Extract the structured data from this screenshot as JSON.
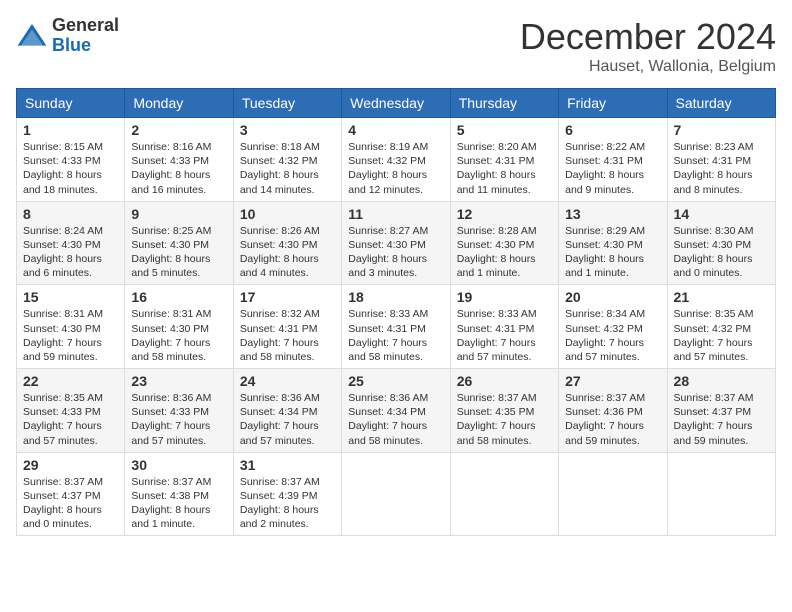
{
  "logo": {
    "general": "General",
    "blue": "Blue"
  },
  "title": "December 2024",
  "location": "Hauset, Wallonia, Belgium",
  "days_of_week": [
    "Sunday",
    "Monday",
    "Tuesday",
    "Wednesday",
    "Thursday",
    "Friday",
    "Saturday"
  ],
  "weeks": [
    [
      {
        "day": 1,
        "sunrise": "8:15 AM",
        "sunset": "4:33 PM",
        "daylight": "8 hours and 18 minutes."
      },
      {
        "day": 2,
        "sunrise": "8:16 AM",
        "sunset": "4:33 PM",
        "daylight": "8 hours and 16 minutes."
      },
      {
        "day": 3,
        "sunrise": "8:18 AM",
        "sunset": "4:32 PM",
        "daylight": "8 hours and 14 minutes."
      },
      {
        "day": 4,
        "sunrise": "8:19 AM",
        "sunset": "4:32 PM",
        "daylight": "8 hours and 12 minutes."
      },
      {
        "day": 5,
        "sunrise": "8:20 AM",
        "sunset": "4:31 PM",
        "daylight": "8 hours and 11 minutes."
      },
      {
        "day": 6,
        "sunrise": "8:22 AM",
        "sunset": "4:31 PM",
        "daylight": "8 hours and 9 minutes."
      },
      {
        "day": 7,
        "sunrise": "8:23 AM",
        "sunset": "4:31 PM",
        "daylight": "8 hours and 8 minutes."
      }
    ],
    [
      {
        "day": 8,
        "sunrise": "8:24 AM",
        "sunset": "4:30 PM",
        "daylight": "8 hours and 6 minutes."
      },
      {
        "day": 9,
        "sunrise": "8:25 AM",
        "sunset": "4:30 PM",
        "daylight": "8 hours and 5 minutes."
      },
      {
        "day": 10,
        "sunrise": "8:26 AM",
        "sunset": "4:30 PM",
        "daylight": "8 hours and 4 minutes."
      },
      {
        "day": 11,
        "sunrise": "8:27 AM",
        "sunset": "4:30 PM",
        "daylight": "8 hours and 3 minutes."
      },
      {
        "day": 12,
        "sunrise": "8:28 AM",
        "sunset": "4:30 PM",
        "daylight": "8 hours and 1 minute."
      },
      {
        "day": 13,
        "sunrise": "8:29 AM",
        "sunset": "4:30 PM",
        "daylight": "8 hours and 1 minute."
      },
      {
        "day": 14,
        "sunrise": "8:30 AM",
        "sunset": "4:30 PM",
        "daylight": "8 hours and 0 minutes."
      }
    ],
    [
      {
        "day": 15,
        "sunrise": "8:31 AM",
        "sunset": "4:30 PM",
        "daylight": "7 hours and 59 minutes."
      },
      {
        "day": 16,
        "sunrise": "8:31 AM",
        "sunset": "4:30 PM",
        "daylight": "7 hours and 58 minutes."
      },
      {
        "day": 17,
        "sunrise": "8:32 AM",
        "sunset": "4:31 PM",
        "daylight": "7 hours and 58 minutes."
      },
      {
        "day": 18,
        "sunrise": "8:33 AM",
        "sunset": "4:31 PM",
        "daylight": "7 hours and 58 minutes."
      },
      {
        "day": 19,
        "sunrise": "8:33 AM",
        "sunset": "4:31 PM",
        "daylight": "7 hours and 57 minutes."
      },
      {
        "day": 20,
        "sunrise": "8:34 AM",
        "sunset": "4:32 PM",
        "daylight": "7 hours and 57 minutes."
      },
      {
        "day": 21,
        "sunrise": "8:35 AM",
        "sunset": "4:32 PM",
        "daylight": "7 hours and 57 minutes."
      }
    ],
    [
      {
        "day": 22,
        "sunrise": "8:35 AM",
        "sunset": "4:33 PM",
        "daylight": "7 hours and 57 minutes."
      },
      {
        "day": 23,
        "sunrise": "8:36 AM",
        "sunset": "4:33 PM",
        "daylight": "7 hours and 57 minutes."
      },
      {
        "day": 24,
        "sunrise": "8:36 AM",
        "sunset": "4:34 PM",
        "daylight": "7 hours and 57 minutes."
      },
      {
        "day": 25,
        "sunrise": "8:36 AM",
        "sunset": "4:34 PM",
        "daylight": "7 hours and 58 minutes."
      },
      {
        "day": 26,
        "sunrise": "8:37 AM",
        "sunset": "4:35 PM",
        "daylight": "7 hours and 58 minutes."
      },
      {
        "day": 27,
        "sunrise": "8:37 AM",
        "sunset": "4:36 PM",
        "daylight": "7 hours and 59 minutes."
      },
      {
        "day": 28,
        "sunrise": "8:37 AM",
        "sunset": "4:37 PM",
        "daylight": "7 hours and 59 minutes."
      }
    ],
    [
      {
        "day": 29,
        "sunrise": "8:37 AM",
        "sunset": "4:37 PM",
        "daylight": "8 hours and 0 minutes."
      },
      {
        "day": 30,
        "sunrise": "8:37 AM",
        "sunset": "4:38 PM",
        "daylight": "8 hours and 1 minute."
      },
      {
        "day": 31,
        "sunrise": "8:37 AM",
        "sunset": "4:39 PM",
        "daylight": "8 hours and 2 minutes."
      },
      null,
      null,
      null,
      null
    ]
  ]
}
